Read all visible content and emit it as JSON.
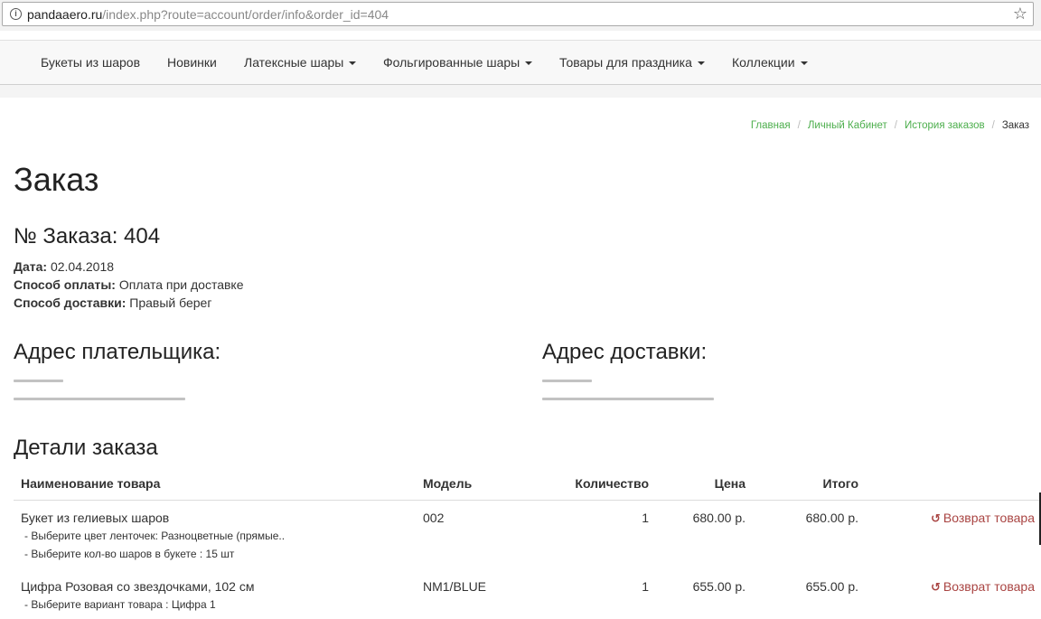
{
  "browser": {
    "url_host": "pandaaero.ru",
    "url_path": "/index.php?route=account/order/info&order_id=404"
  },
  "nav": {
    "items": [
      {
        "label": "Букеты из шаров"
      },
      {
        "label": "Новинки"
      },
      {
        "label": "Латексные шары"
      },
      {
        "label": "Фольгированные шары"
      },
      {
        "label": "Товары для праздника"
      },
      {
        "label": "Коллекции"
      }
    ]
  },
  "breadcrumb": [
    "Главная",
    "Личный Кабинет",
    "История заказов",
    "Заказ"
  ],
  "page_title": "Заказ",
  "order": {
    "number_label": "№ Заказа: 404",
    "date_label": "Дата:",
    "date_value": "02.04.2018",
    "payment_label": "Способ оплаты:",
    "payment_value": "Оплата при доставке",
    "shipping_label": "Способ доставки:",
    "shipping_value": "Правый берег"
  },
  "addresses": {
    "payment_title": "Адрес плательщика:",
    "shipping_title": "Адрес доставки:"
  },
  "details_title": "Детали заказа",
  "table": {
    "headers": [
      "Наименование товара",
      "Модель",
      "Количество",
      "Цена",
      "Итого"
    ],
    "return_label": "Возврат товара",
    "rows": [
      {
        "name": "Букет из гелиевых шаров",
        "options": [
          "- Выберите цвет ленточек: Разноцветные (прямые..",
          "- Выберите кол-во шаров в букете : 15 шт"
        ],
        "model": "002",
        "quantity": "1",
        "price": "680.00 р.",
        "total": "680.00 р."
      },
      {
        "name": "Цифра Розовая со звездочками, 102 см",
        "options": [
          "- Выберите вариант товара : Цифра 1"
        ],
        "model": "NM1/BLUE",
        "quantity": "1",
        "price": "655.00 р.",
        "total": "655.00 р."
      }
    ]
  }
}
